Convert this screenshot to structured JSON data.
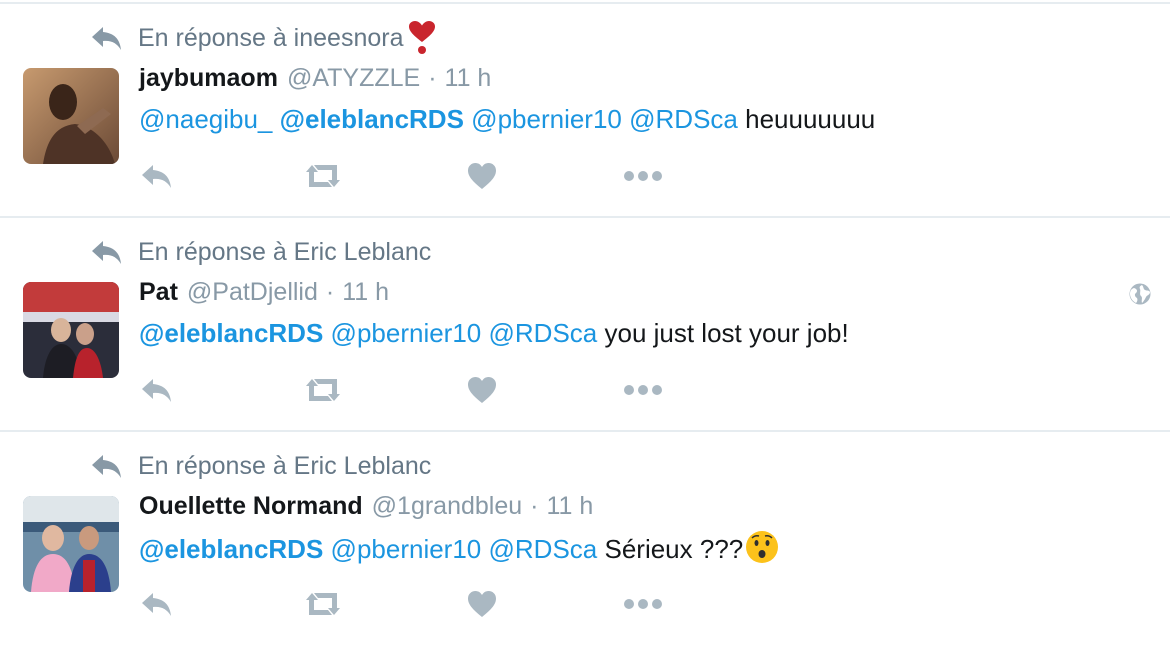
{
  "colors": {
    "link": "#1b95e0",
    "muted": "#8899a6",
    "action_icon": "#aab8c2",
    "text": "#14171a",
    "heart_emoji": "#c9252d"
  },
  "tweets": [
    {
      "context": {
        "prefix": "En réponse à",
        "target": "ineesnora",
        "emoji": "heavy-heart-exclamation-icon"
      },
      "author": {
        "name": "jaybumaom",
        "handle": "@ATYZZLE",
        "time": "11 h"
      },
      "text": [
        {
          "kind": "mention",
          "value": "@naegibu_",
          "bold": false
        },
        {
          "kind": "mention",
          "value": "@eleblancRDS",
          "bold": true
        },
        {
          "kind": "mention",
          "value": "@pbernier10",
          "bold": false
        },
        {
          "kind": "mention",
          "value": "@RDSca",
          "bold": false
        },
        {
          "kind": "text",
          "value": "heuuuuuuu"
        }
      ],
      "globe": false
    },
    {
      "context": {
        "prefix": "En réponse à",
        "target": "Eric Leblanc"
      },
      "author": {
        "name": "Pat",
        "handle": "@PatDjellid",
        "time": "11 h"
      },
      "text": [
        {
          "kind": "mention",
          "value": "@eleblancRDS",
          "bold": true
        },
        {
          "kind": "mention",
          "value": "@pbernier10",
          "bold": false
        },
        {
          "kind": "mention",
          "value": "@RDSca",
          "bold": false
        },
        {
          "kind": "text",
          "value": "you just lost your job!"
        }
      ],
      "globe": true
    },
    {
      "context": {
        "prefix": "En réponse à",
        "target": "Eric Leblanc"
      },
      "author": {
        "name": "Ouellette Normand",
        "handle": "@1grandbleu",
        "time": "11 h"
      },
      "text": [
        {
          "kind": "mention",
          "value": "@eleblancRDS",
          "bold": true
        },
        {
          "kind": "mention",
          "value": "@pbernier10",
          "bold": false
        },
        {
          "kind": "mention",
          "value": "@RDSca",
          "bold": false
        },
        {
          "kind": "text",
          "value": "Sérieux ???"
        }
      ],
      "emoji": "hushed-face-icon",
      "globe": false
    }
  ],
  "separator": "·",
  "actions": [
    "reply-icon",
    "retweet-icon",
    "like-icon",
    "more-icon"
  ]
}
